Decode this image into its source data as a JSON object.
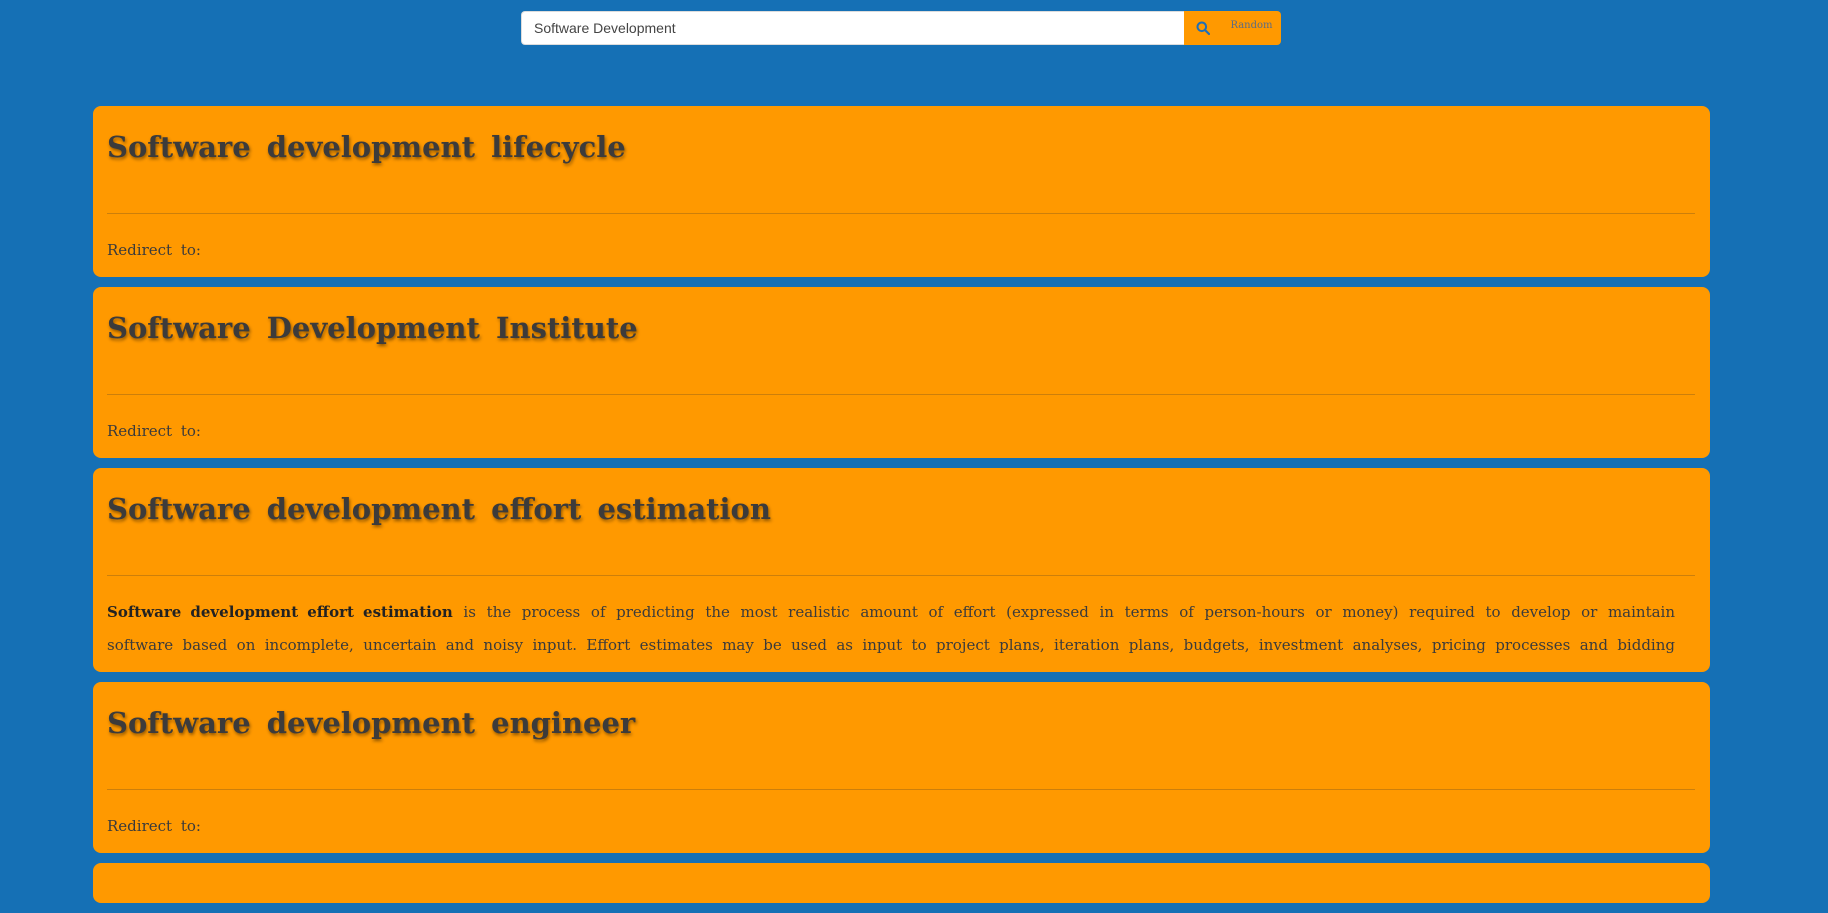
{
  "search": {
    "value": "Software Development",
    "placeholder": "",
    "random_label": "Random",
    "icon": "search-icon"
  },
  "colors": {
    "background": "#1570b5",
    "card": "#ff9900",
    "title_text": "#3c3b3b"
  },
  "results": [
    {
      "title": "Software development lifecycle",
      "snippet": "Redirect to:"
    },
    {
      "title": "Software Development Institute",
      "snippet": "Redirect to:"
    },
    {
      "title": "Software development effort estimation",
      "snippet_bold": "Software development effort estimation",
      "snippet": " is the process of predicting the most realistic amount of effort (expressed in terms of person-hours or money) required to develop or maintain software based on incomplete, uncertain and noisy input. Effort estimates may be used as input to project plans, iteration plans, budgets, investment analyses, pricing processes and bidding rounds."
    },
    {
      "title": "Software development engineer",
      "snippet": "Redirect to:"
    }
  ]
}
